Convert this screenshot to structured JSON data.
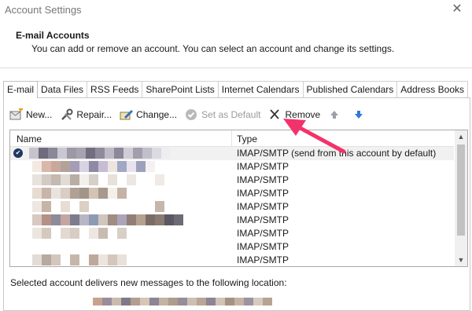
{
  "window": {
    "title": "Account Settings"
  },
  "header": {
    "heading": "E-mail Accounts",
    "description": "You can add or remove an account. You can select an account and change its settings."
  },
  "tabs": [
    {
      "label": "E-mail",
      "active": true
    },
    {
      "label": "Data Files",
      "active": false
    },
    {
      "label": "RSS Feeds",
      "active": false
    },
    {
      "label": "SharePoint Lists",
      "active": false
    },
    {
      "label": "Internet Calendars",
      "active": false
    },
    {
      "label": "Published Calendars",
      "active": false
    },
    {
      "label": "Address Books",
      "active": false
    }
  ],
  "toolbar": {
    "new_label": "New...",
    "repair_label": "Repair...",
    "change_label": "Change...",
    "set_default_label": "Set as Default",
    "remove_label": "Remove"
  },
  "accounts_list": {
    "columns": {
      "name": "Name",
      "type": "Type"
    },
    "rows": [
      {
        "type": "IMAP/SMTP (send from this account by default)",
        "is_default": true
      },
      {
        "type": "IMAP/SMTP",
        "is_default": false
      },
      {
        "type": "IMAP/SMTP",
        "is_default": false
      },
      {
        "type": "IMAP/SMTP",
        "is_default": false
      },
      {
        "type": "IMAP/SMTP",
        "is_default": false
      },
      {
        "type": "IMAP/SMTP",
        "is_default": false
      },
      {
        "type": "IMAP/SMTP",
        "is_default": false
      },
      {
        "type": "IMAP/SMTP",
        "is_default": false
      },
      {
        "type": "IMAP/SMTP",
        "is_default": false
      }
    ]
  },
  "delivery": {
    "label": "Selected account delivers new messages to the following location:"
  },
  "colors": {
    "annotation_arrow": "#f2336b",
    "default_icon": "#1f3864",
    "move_up_arrow": "#9aa0a6",
    "move_down_arrow": "#2f7ad8"
  }
}
